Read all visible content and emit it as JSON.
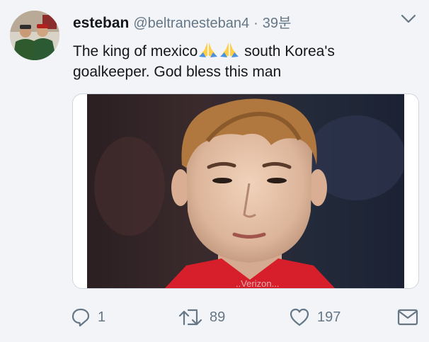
{
  "tweet": {
    "display_name": "esteban",
    "handle": "@beltranesteban4",
    "separator": "·",
    "time": "39분",
    "text_part1": "The king of mexico",
    "text_part2": " south Korea's goalkeeper. God bless this man",
    "emoji": [
      "folded-hands",
      "folded-hands"
    ],
    "image_watermark": "..Verizon..."
  },
  "actions": {
    "reply_count": "1",
    "retweet_count": "89",
    "like_count": "197"
  },
  "colors": {
    "background": "#f2f4f7",
    "text": "#14171a",
    "secondary_text": "#657786"
  }
}
